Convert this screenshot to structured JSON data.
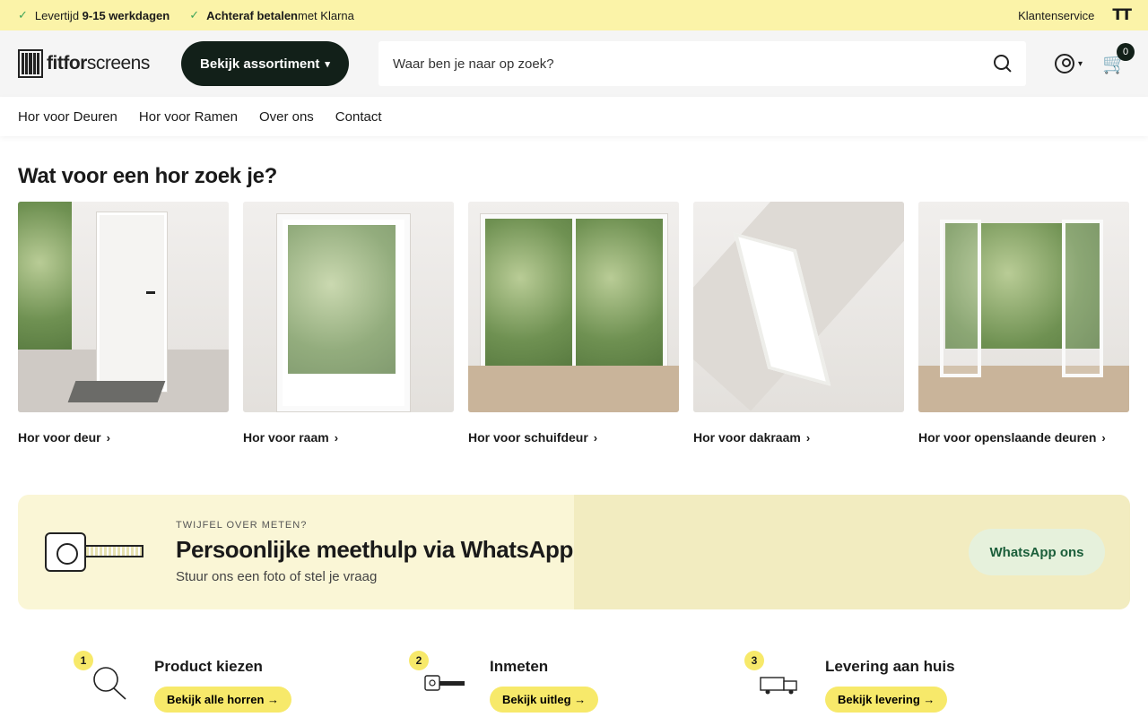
{
  "topbar": {
    "usp1_prefix": "Levertijd ",
    "usp1_bold": "9-15 werkdagen",
    "usp2_bold": "Achteraf betalen",
    "usp2_suffix": " met Klarna",
    "service": "Klantenservice",
    "text_size_icon": "TT"
  },
  "header": {
    "logo_bold": "fitfor",
    "logo_rest": "screens",
    "assortment_btn": "Bekijk assortiment",
    "search_placeholder": "Waar ben je naar op zoek?",
    "cart_count": "0"
  },
  "nav": {
    "items": [
      "Hor voor Deuren",
      "Hor voor Ramen",
      "Over ons",
      "Contact"
    ]
  },
  "categories": {
    "title": "Wat voor een hor zoek je?",
    "items": [
      {
        "label": "Hor voor deur"
      },
      {
        "label": "Hor voor raam"
      },
      {
        "label": "Hor voor schuifdeur"
      },
      {
        "label": "Hor voor dakraam"
      },
      {
        "label": "Hor voor openslaande deuren"
      }
    ]
  },
  "banner": {
    "eyebrow": "TWIJFEL OVER METEN?",
    "headline": "Persoonlijke meethulp via WhatsApp",
    "sub": "Stuur ons een foto of stel je vraag",
    "button": "WhatsApp ons"
  },
  "steps": [
    {
      "num": "1",
      "title": "Product kiezen",
      "button": "Bekijk alle horren →"
    },
    {
      "num": "2",
      "title": "Inmeten",
      "button": "Bekijk uitleg →"
    },
    {
      "num": "3",
      "title": "Levering aan huis",
      "button": "Bekijk levering →"
    }
  ],
  "colors": {
    "accent_yellow": "#fbf3a8",
    "dark_green": "#122019",
    "step_yellow": "#f7e96a"
  }
}
